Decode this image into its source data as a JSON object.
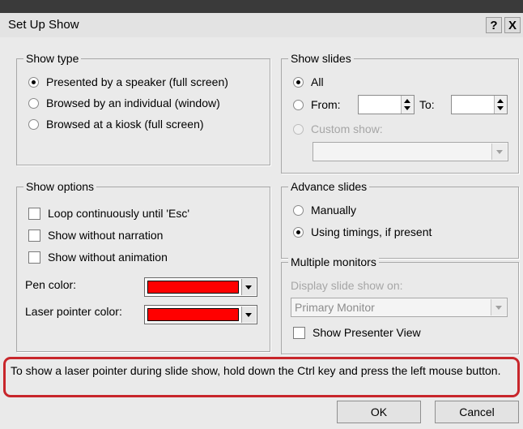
{
  "title": "Set Up Show",
  "title_buttons": {
    "help": "?",
    "close": "X"
  },
  "show_type": {
    "legend": "Show type",
    "options": [
      {
        "label": "Presented by a speaker (full screen)",
        "selected": true
      },
      {
        "label": "Browsed by an individual (window)",
        "selected": false
      },
      {
        "label": "Browsed at a kiosk (full screen)",
        "selected": false
      }
    ]
  },
  "show_slides": {
    "legend": "Show slides",
    "all_label": "All",
    "from_label": "From:",
    "from_value": "",
    "to_label": "To:",
    "to_value": "",
    "custom_label": "Custom show:",
    "custom_value": ""
  },
  "show_options": {
    "legend": "Show options",
    "loop_label": "Loop continuously until 'Esc'",
    "no_narration_label": "Show without narration",
    "no_animation_label": "Show without animation",
    "pen_color_label": "Pen color:",
    "pen_color": "#ff0000",
    "laser_color_label": "Laser pointer color:",
    "laser_color": "#ff0000"
  },
  "advance_slides": {
    "legend": "Advance slides",
    "manually_label": "Manually",
    "timings_label": "Using timings, if present"
  },
  "multiple_monitors": {
    "legend": "Multiple monitors",
    "display_label": "Display slide show on:",
    "monitor_value": "Primary Monitor",
    "presenter_view_label": "Show Presenter View"
  },
  "hint": "To show a laser pointer during slide show, hold down the Ctrl key and press the left mouse button.",
  "buttons": {
    "ok": "OK",
    "cancel": "Cancel"
  },
  "colors": {
    "highlight": "#c8262b",
    "dialog_bg": "#eaeaea"
  }
}
